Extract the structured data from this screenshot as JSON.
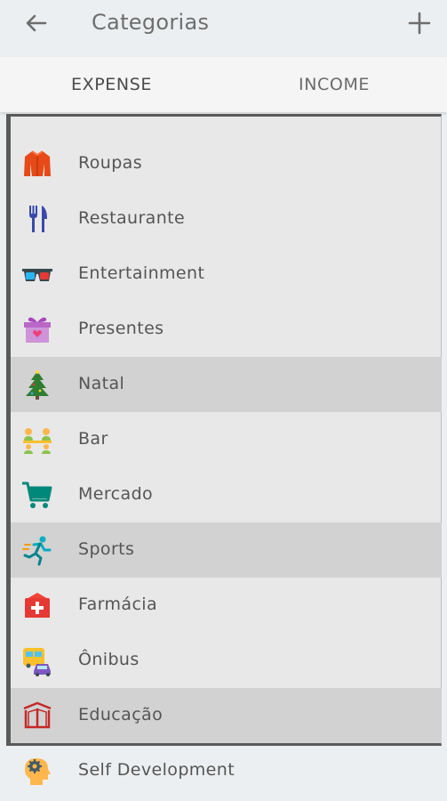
{
  "appbar": {
    "title": "Categorias",
    "back_icon": "arrow-left-icon",
    "add_icon": "plus-icon"
  },
  "tabs": [
    {
      "label": "EXPENSE"
    },
    {
      "label": "INCOME"
    }
  ],
  "categories": [
    {
      "label": "Roupas",
      "icon": "jacket-icon",
      "highlighted": false
    },
    {
      "label": "Restaurante",
      "icon": "fork-knife-icon",
      "highlighted": false
    },
    {
      "label": "Entertainment",
      "icon": "3d-glasses-icon",
      "highlighted": false
    },
    {
      "label": "Presentes",
      "icon": "gift-icon",
      "highlighted": false
    },
    {
      "label": "Natal",
      "icon": "christmas-tree-icon",
      "highlighted": true
    },
    {
      "label": "Bar",
      "icon": "people-table-icon",
      "highlighted": false
    },
    {
      "label": "Mercado",
      "icon": "shopping-cart-icon",
      "highlighted": false
    },
    {
      "label": "Sports",
      "icon": "runner-icon",
      "highlighted": true
    },
    {
      "label": "Farmácia",
      "icon": "first-aid-icon",
      "highlighted": false
    },
    {
      "label": "Ônibus",
      "icon": "bus-icon",
      "highlighted": false
    },
    {
      "label": "Educação",
      "icon": "book-icon",
      "highlighted": true
    },
    {
      "label": "Self Development",
      "icon": "head-gear-icon",
      "highlighted": false
    }
  ],
  "colors": {
    "background": "#eceff1",
    "highlight": "#d2d2d2",
    "frame_border": "#5a5a5a"
  }
}
